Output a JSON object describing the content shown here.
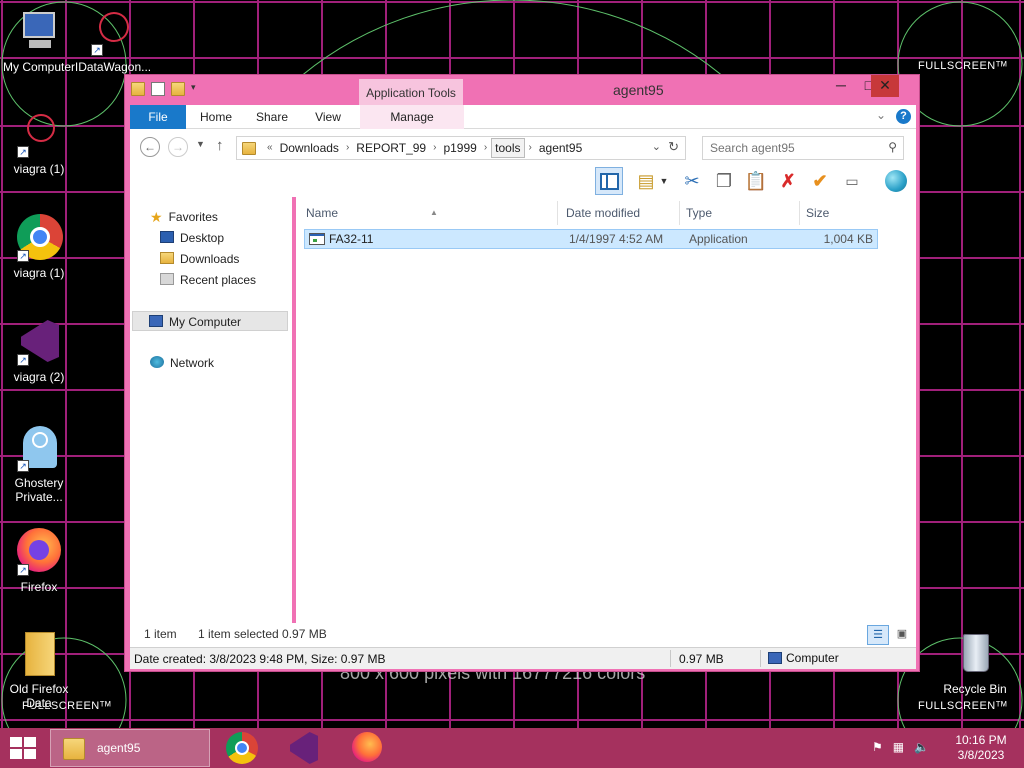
{
  "desktop": {
    "background_text": "800 x 600 pixels with 16777216 colors",
    "corner_labels": [
      "FULLSCREENᵀᴹ",
      "FULLSCREENᵀᴹ",
      "FULLSCREENᵀᴹ"
    ],
    "icons": [
      {
        "label": "My Computer"
      },
      {
        "label": "IDataWagon..."
      },
      {
        "label": "viagra (1)"
      },
      {
        "label": "viagra (1)"
      },
      {
        "label": "viagra (2)"
      },
      {
        "label": "Ghostery Private..."
      },
      {
        "label": "Firefox"
      },
      {
        "label": "Old Firefox Data"
      },
      {
        "label": "Recycle Bin"
      }
    ]
  },
  "window": {
    "title": "agent95",
    "contextual_group": "Application Tools",
    "ribbon_tabs": {
      "file": "File",
      "home": "Home",
      "share": "Share",
      "view": "View",
      "manage": "Manage"
    },
    "address": {
      "overflow": "«",
      "crumbs": [
        "Downloads",
        "REPORT_99",
        "p1999",
        "tools",
        "agent95"
      ],
      "highlighted_crumb": "tools"
    },
    "search": {
      "placeholder": "Search agent95"
    },
    "navigation": {
      "favorites": "Favorites",
      "desktop": "Desktop",
      "downloads": "Downloads",
      "recent_places": "Recent places",
      "my_computer": "My Computer",
      "network": "Network"
    },
    "columns": {
      "name": "Name",
      "date_modified": "Date modified",
      "type": "Type",
      "size": "Size"
    },
    "files": [
      {
        "name": "FA32-11",
        "date_modified": "1/4/1997 4:52 AM",
        "type": "Application",
        "size": "1,004 KB",
        "selected": true
      }
    ],
    "status": {
      "item_count": "1 item",
      "selection": "1 item selected  0.97 MB"
    },
    "details_bar": {
      "created": "Date created: 3/8/2023 9:48 PM, Size: 0.97 MB",
      "size": "0.97 MB",
      "zone": "Computer"
    }
  },
  "taskbar": {
    "active_window": "agent95",
    "clock": {
      "time": "10:16 PM",
      "date": "3/8/2023"
    },
    "pinned": [
      "chrome-icon",
      "visual-studio-icon",
      "firefox-icon"
    ]
  },
  "colors": {
    "window_frame": "#f071b4",
    "taskbar": "#a5315e",
    "file_tab": "#1979ca",
    "selection": "#cce8ff"
  }
}
